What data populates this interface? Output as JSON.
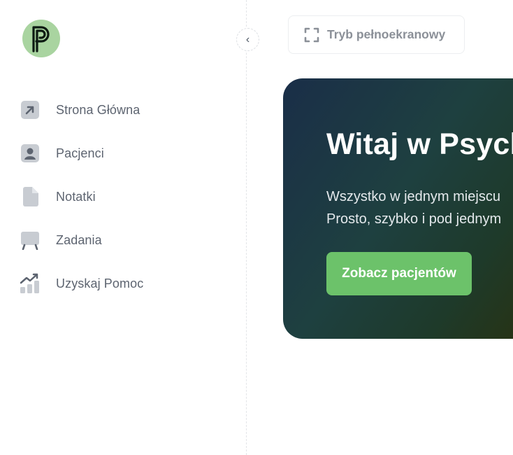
{
  "sidebar": {
    "logo_letter": "P",
    "collapse_glyph": "‹",
    "items": [
      {
        "label": "Strona Główna",
        "icon": "arrow-up-right-icon"
      },
      {
        "label": "Pacjenci",
        "icon": "user-icon"
      },
      {
        "label": "Notatki",
        "icon": "document-icon"
      },
      {
        "label": "Zadania",
        "icon": "board-icon"
      },
      {
        "label": "Uzyskaj Pomoc",
        "icon": "chart-trend-icon"
      }
    ]
  },
  "toolbar": {
    "fullscreen_label": "Tryb pełnoekranowy",
    "fullscreen_icon": "expand-icon"
  },
  "hero": {
    "title": "Witaj w Psych",
    "line1": "Wszystko w jednym miejscu",
    "line2": "Prosto, szybko i pod jednym",
    "cta_label": "Zobacz pacjentów"
  },
  "colors": {
    "accent_green": "#6cc26a",
    "logo_bg": "#a9d4a0",
    "nav_text": "#5d6470",
    "icon_gray": "#c8ccd2"
  }
}
